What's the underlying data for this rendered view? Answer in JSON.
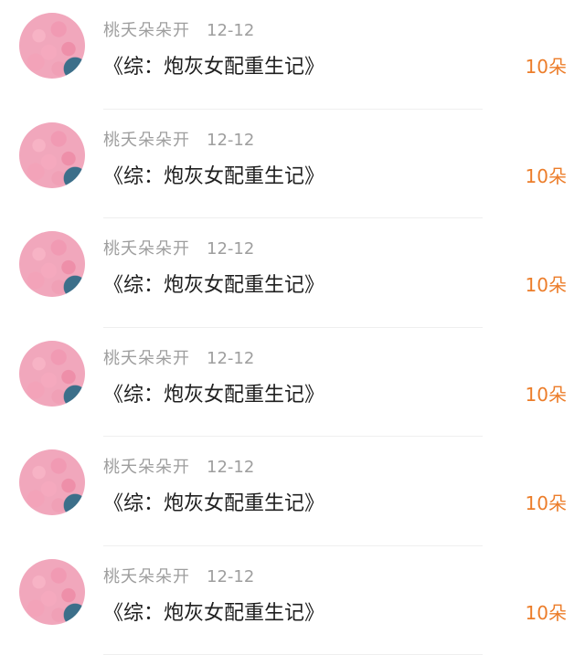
{
  "colors": {
    "username": "#9e9e9e",
    "title": "#1f1f1f",
    "amount": "#ec7d2a",
    "divider": "#efefef"
  },
  "items": [
    {
      "avatar": "avatar-image",
      "username": "桃夭朵朵开",
      "date": "12-12",
      "title": "《综：炮灰女配重生记》",
      "amount": "10朵"
    },
    {
      "avatar": "avatar-image",
      "username": "桃夭朵朵开",
      "date": "12-12",
      "title": "《综：炮灰女配重生记》",
      "amount": "10朵"
    },
    {
      "avatar": "avatar-image",
      "username": "桃夭朵朵开",
      "date": "12-12",
      "title": "《综：炮灰女配重生记》",
      "amount": "10朵"
    },
    {
      "avatar": "avatar-image",
      "username": "桃夭朵朵开",
      "date": "12-12",
      "title": "《综：炮灰女配重生记》",
      "amount": "10朵"
    },
    {
      "avatar": "avatar-image",
      "username": "桃夭朵朵开",
      "date": "12-12",
      "title": "《综：炮灰女配重生记》",
      "amount": "10朵"
    },
    {
      "avatar": "avatar-image",
      "username": "桃夭朵朵开",
      "date": "12-12",
      "title": "《综：炮灰女配重生记》",
      "amount": "10朵"
    }
  ]
}
